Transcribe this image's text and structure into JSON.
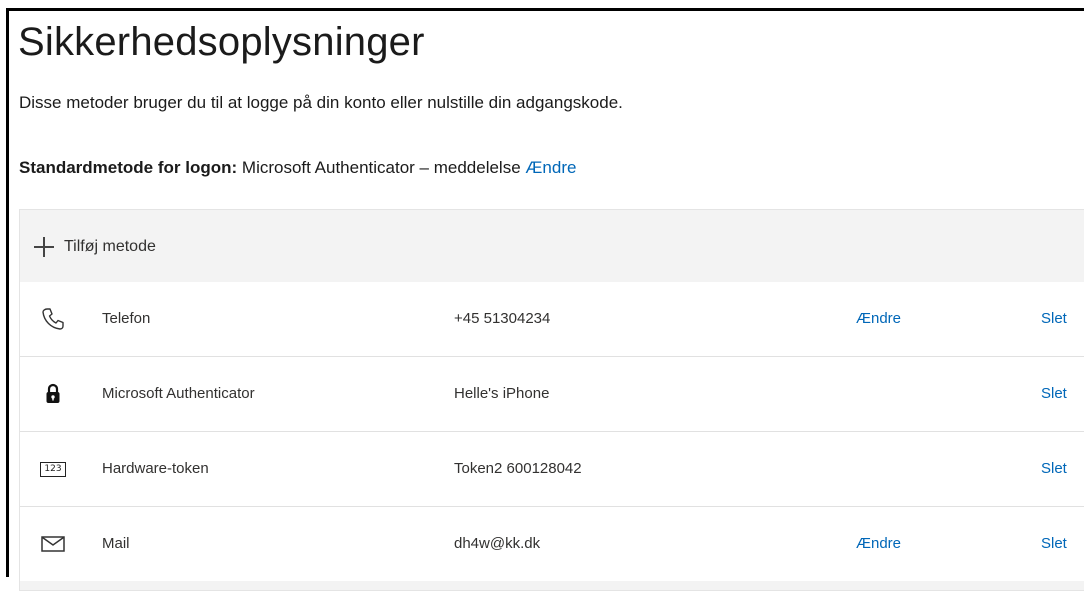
{
  "page": {
    "title": "Sikkerhedsoplysninger",
    "description": "Disse metoder bruger du til at logge på din konto eller nulstille din adgangskode.",
    "default_method_label": "Standardmetode for logon:",
    "default_method_value": "Microsoft Authenticator – meddelelse",
    "default_method_change": "Ændre"
  },
  "add_method": {
    "label": "Tilføj metode",
    "icon": "plus-icon"
  },
  "methods": [
    {
      "icon": "phone-icon",
      "name": "Telefon",
      "detail": "+45 51304234",
      "change": "Ændre",
      "delete": "Slet"
    },
    {
      "icon": "lock-icon",
      "name": "Microsoft Authenticator",
      "detail": "Helle's iPhone",
      "change": "",
      "delete": "Slet"
    },
    {
      "icon": "token-icon",
      "icon_text": "123",
      "name": "Hardware-token",
      "detail": "Token2 600128042",
      "change": "",
      "delete": "Slet"
    },
    {
      "icon": "mail-icon",
      "name": "Mail",
      "detail": "dh4w@kk.dk",
      "change": "Ændre",
      "delete": "Slet"
    }
  ],
  "colors": {
    "link": "#0067b8",
    "panel": "#f3f3f3",
    "text": "#1b1b1b"
  }
}
